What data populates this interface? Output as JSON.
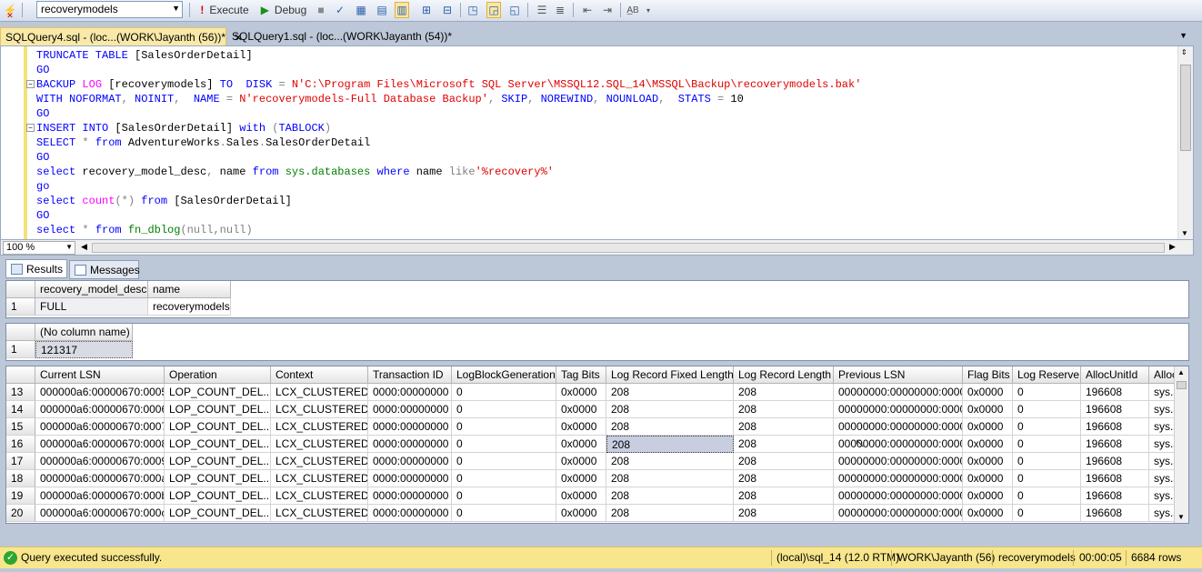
{
  "toolbar": {
    "database": "recoverymodels",
    "execute_label": "Execute",
    "debug_label": "Debug"
  },
  "tabs": [
    {
      "label": "SQLQuery4.sql - (loc...(WORK\\Jayanth (56))*",
      "active": true
    },
    {
      "label": "SQLQuery1.sql - (loc...(WORK\\Jayanth (54))*",
      "active": false
    }
  ],
  "editor": {
    "lines": [
      "TRUNCATE TABLE [SalesOrderDetail]",
      "GO",
      "BACKUP LOG [recoverymodels] TO  DISK = N'C:\\Program Files\\Microsoft SQL Server\\MSSQL12.SQL_14\\MSSQL\\Backup\\recoverymodels.bak'",
      "WITH NOFORMAT, NOINIT,  NAME = N'recoverymodels-Full Database Backup', SKIP, NOREWIND, NOUNLOAD,  STATS = 10",
      "GO",
      "INSERT INTO [SalesOrderDetail] with (TABLOCK)",
      "SELECT * from AdventureWorks.Sales.SalesOrderDetail",
      "GO",
      "select recovery_model_desc, name from sys.databases where name like'%recovery%'",
      "go",
      "select count(*) from [SalesOrderDetail]",
      "GO",
      "select * from fn_dblog(null,null)"
    ]
  },
  "zoom": "100 %",
  "result_tabs": {
    "results": "Results",
    "messages": "Messages"
  },
  "grid1": {
    "columns": [
      "recovery_model_desc",
      "name"
    ],
    "rows": [
      [
        "1",
        "FULL",
        "recoverymodels"
      ]
    ]
  },
  "grid2": {
    "columns": [
      "(No column name)"
    ],
    "rows": [
      [
        "1",
        "121317"
      ]
    ]
  },
  "grid3": {
    "columns": [
      "Current LSN",
      "Operation",
      "Context",
      "Transaction ID",
      "LogBlockGeneration",
      "Tag Bits",
      "Log Record Fixed Length",
      "Log Record Length",
      "Previous LSN",
      "Flag Bits",
      "Log Reserve",
      "AllocUnitId",
      "AllocU"
    ],
    "rows": [
      [
        "13",
        "000000a6:00000670:0005",
        "LOP_COUNT_DEL...",
        "LCX_CLUSTERED",
        "0000:00000000",
        "0",
        "0x0000",
        "208",
        "208",
        "00000000:00000000:0000",
        "0x0000",
        "0",
        "196608",
        "sys.s"
      ],
      [
        "14",
        "000000a6:00000670:0006",
        "LOP_COUNT_DEL...",
        "LCX_CLUSTERED",
        "0000:00000000",
        "0",
        "0x0000",
        "208",
        "208",
        "00000000:00000000:0000",
        "0x0000",
        "0",
        "196608",
        "sys.s"
      ],
      [
        "15",
        "000000a6:00000670:0007",
        "LOP_COUNT_DEL...",
        "LCX_CLUSTERED",
        "0000:00000000",
        "0",
        "0x0000",
        "208",
        "208",
        "00000000:00000000:0000",
        "0x0000",
        "0",
        "196608",
        "sys.s"
      ],
      [
        "16",
        "000000a6:00000670:0008",
        "LOP_COUNT_DEL...",
        "LCX_CLUSTERED",
        "0000:00000000",
        "0",
        "0x0000",
        "208",
        "208",
        "00000000:00000000:0000",
        "0x0000",
        "0",
        "196608",
        "sys.s"
      ],
      [
        "17",
        "000000a6:00000670:0009",
        "LOP_COUNT_DEL...",
        "LCX_CLUSTERED",
        "0000:00000000",
        "0",
        "0x0000",
        "208",
        "208",
        "00000000:00000000:0000",
        "0x0000",
        "0",
        "196608",
        "sys.s"
      ],
      [
        "18",
        "000000a6:00000670:000a",
        "LOP_COUNT_DEL...",
        "LCX_CLUSTERED",
        "0000:00000000",
        "0",
        "0x0000",
        "208",
        "208",
        "00000000:00000000:0000",
        "0x0000",
        "0",
        "196608",
        "sys.s"
      ],
      [
        "19",
        "000000a6:00000670:000b",
        "LOP_COUNT_DEL...",
        "LCX_CLUSTERED",
        "0000:00000000",
        "0",
        "0x0000",
        "208",
        "208",
        "00000000:00000000:0000",
        "0x0000",
        "0",
        "196608",
        "sys.s"
      ],
      [
        "20",
        "000000a6:00000670:000c",
        "LOP_COUNT_DEL...",
        "LCX_CLUSTERED",
        "0000:00000000",
        "0",
        "0x0000",
        "208",
        "208",
        "00000000:00000000:0000",
        "0x0000",
        "0",
        "196608",
        "sys.s"
      ]
    ]
  },
  "status": {
    "message": "Query executed successfully.",
    "server": "(local)\\sql_14 (12.0 RTM)",
    "user": "WORK\\Jayanth (56)",
    "database": "recoverymodels",
    "elapsed": "00:00:05",
    "rows": "6684 rows"
  }
}
